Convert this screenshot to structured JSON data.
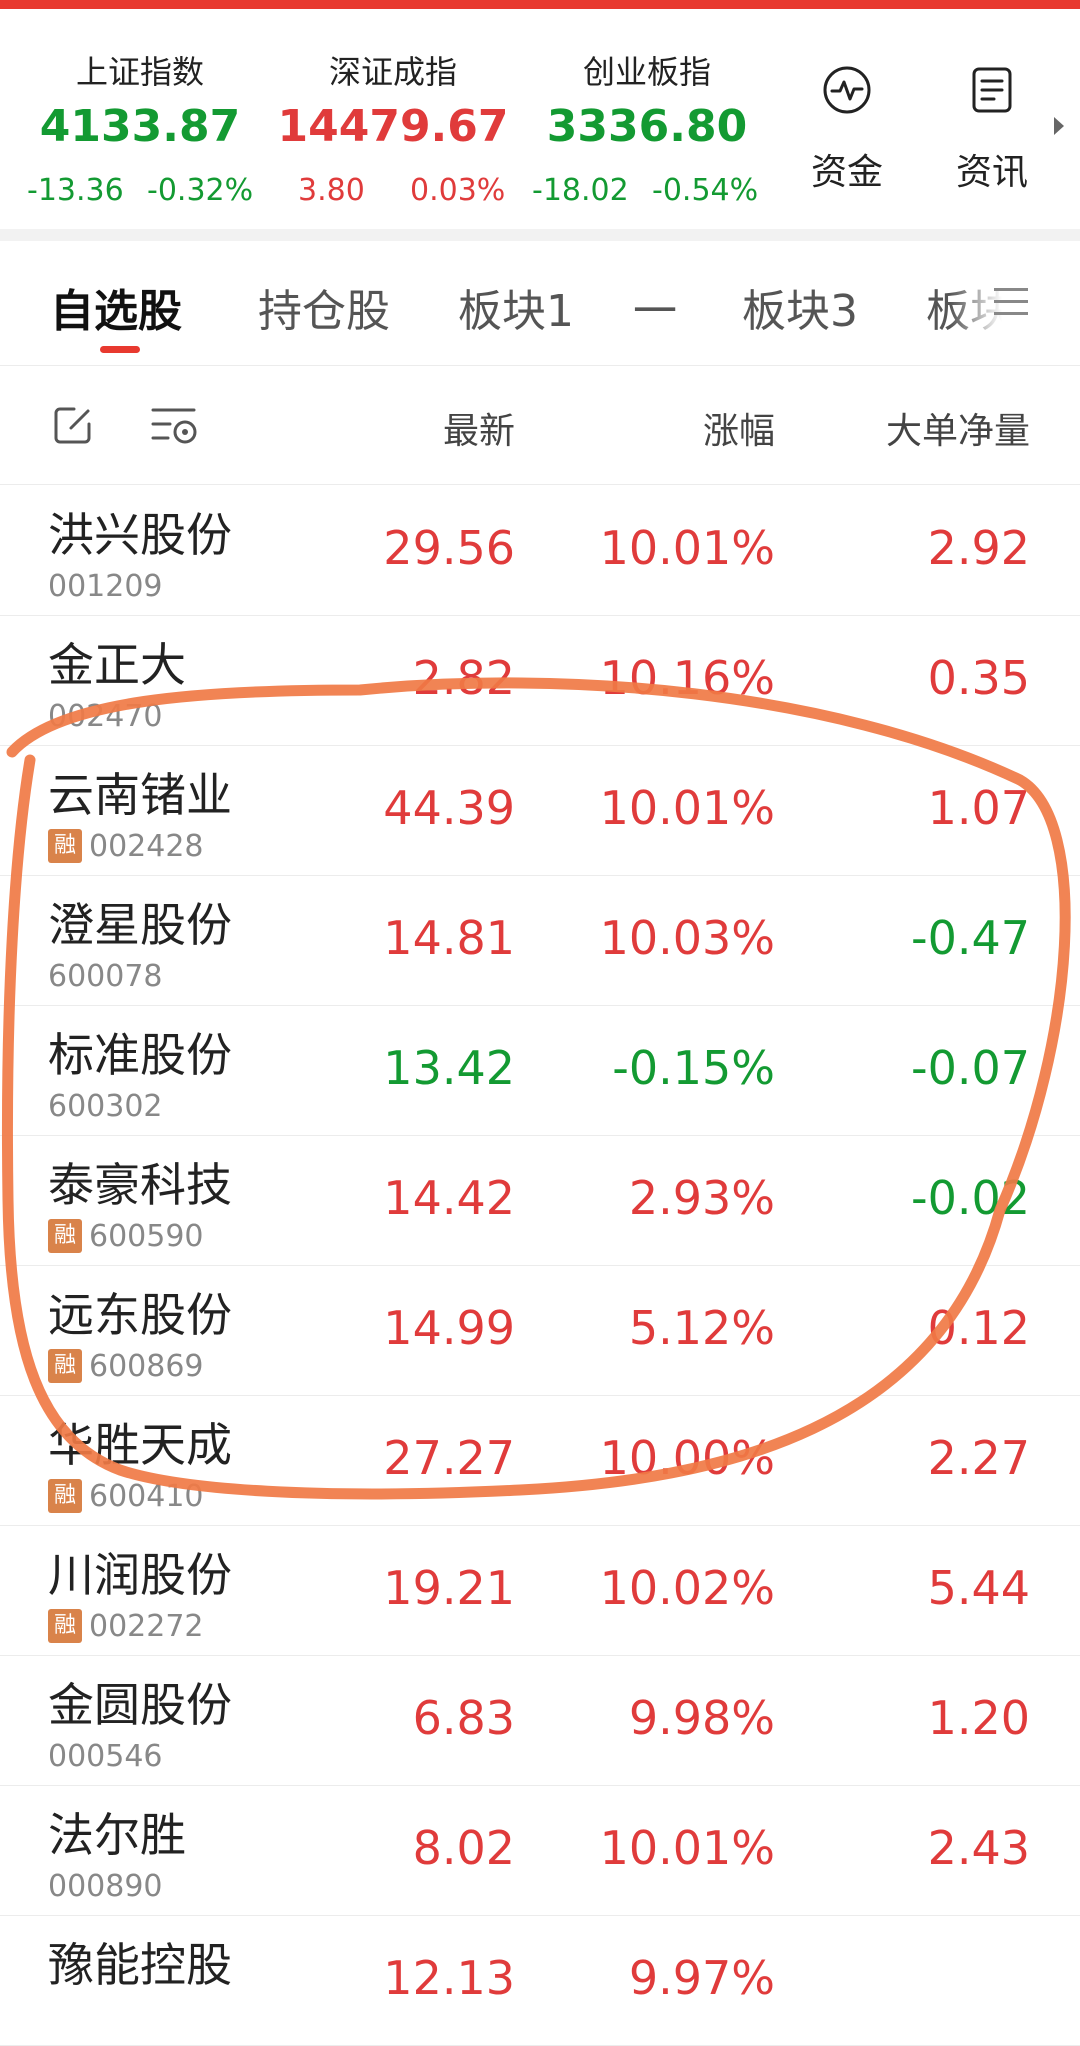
{
  "indices": [
    {
      "name": "上证指数",
      "value": "4133.87",
      "change": "-13.36",
      "percent": "-0.32%",
      "trend": "down"
    },
    {
      "name": "深证成指",
      "value": "14479.67",
      "change": "3.80",
      "percent": "0.03%",
      "trend": "up"
    },
    {
      "name": "创业板指",
      "value": "3336.80",
      "change": "-18.02",
      "percent": "-0.54%",
      "trend": "down"
    }
  ],
  "quick_buttons": [
    {
      "label": "资金",
      "icon": "pulse-chart-icon"
    },
    {
      "label": "资讯",
      "icon": "news-document-icon"
    }
  ],
  "tabs": [
    "自选股",
    "持仓股",
    "板块1",
    "一",
    "板块3",
    "板块"
  ],
  "active_tab": 0,
  "columns": {
    "latest": "最新",
    "change_pct": "涨幅",
    "net_flow": "大单净量"
  },
  "margin_badge": "融",
  "colors": {
    "up": "#e03b3b",
    "down": "#139a32",
    "accent": "#e8392f",
    "badge": "#d9834a",
    "annotation": "#f07a45"
  },
  "stocks": [
    {
      "name": "洪兴股份",
      "code": "001209",
      "margin": false,
      "latest": "29.56",
      "pct": "10.01%",
      "flow": "2.92",
      "latest_trend": "up",
      "pct_trend": "up",
      "flow_trend": "up"
    },
    {
      "name": "金正大",
      "code": "002470",
      "margin": false,
      "latest": "2.82",
      "pct": "10.16%",
      "flow": "0.35",
      "latest_trend": "up",
      "pct_trend": "up",
      "flow_trend": "up"
    },
    {
      "name": "云南锗业",
      "code": "002428",
      "margin": true,
      "latest": "44.39",
      "pct": "10.01%",
      "flow": "1.07",
      "latest_trend": "up",
      "pct_trend": "up",
      "flow_trend": "up"
    },
    {
      "name": "澄星股份",
      "code": "600078",
      "margin": false,
      "latest": "14.81",
      "pct": "10.03%",
      "flow": "-0.47",
      "latest_trend": "up",
      "pct_trend": "up",
      "flow_trend": "down"
    },
    {
      "name": "标准股份",
      "code": "600302",
      "margin": false,
      "latest": "13.42",
      "pct": "-0.15%",
      "flow": "-0.07",
      "latest_trend": "down",
      "pct_trend": "down",
      "flow_trend": "down"
    },
    {
      "name": "泰豪科技",
      "code": "600590",
      "margin": true,
      "latest": "14.42",
      "pct": "2.93%",
      "flow": "-0.02",
      "latest_trend": "up",
      "pct_trend": "up",
      "flow_trend": "down"
    },
    {
      "name": "远东股份",
      "code": "600869",
      "margin": true,
      "latest": "14.99",
      "pct": "5.12%",
      "flow": "0.12",
      "latest_trend": "up",
      "pct_trend": "up",
      "flow_trend": "up"
    },
    {
      "name": "华胜天成",
      "code": "600410",
      "margin": true,
      "latest": "27.27",
      "pct": "10.00%",
      "flow": "2.27",
      "latest_trend": "up",
      "pct_trend": "up",
      "flow_trend": "up"
    },
    {
      "name": "川润股份",
      "code": "002272",
      "margin": true,
      "latest": "19.21",
      "pct": "10.02%",
      "flow": "5.44",
      "latest_trend": "up",
      "pct_trend": "up",
      "flow_trend": "up"
    },
    {
      "name": "金圆股份",
      "code": "000546",
      "margin": false,
      "latest": "6.83",
      "pct": "9.98%",
      "flow": "1.20",
      "latest_trend": "up",
      "pct_trend": "up",
      "flow_trend": "up"
    },
    {
      "name": "法尔胜",
      "code": "000890",
      "margin": false,
      "latest": "8.02",
      "pct": "10.01%",
      "flow": "2.43",
      "latest_trend": "up",
      "pct_trend": "up",
      "flow_trend": "up"
    },
    {
      "name": "豫能控股",
      "code": "",
      "margin": false,
      "latest": "12.13",
      "pct": "9.97%",
      "flow": "",
      "latest_trend": "up",
      "pct_trend": "up",
      "flow_trend": "up"
    }
  ]
}
